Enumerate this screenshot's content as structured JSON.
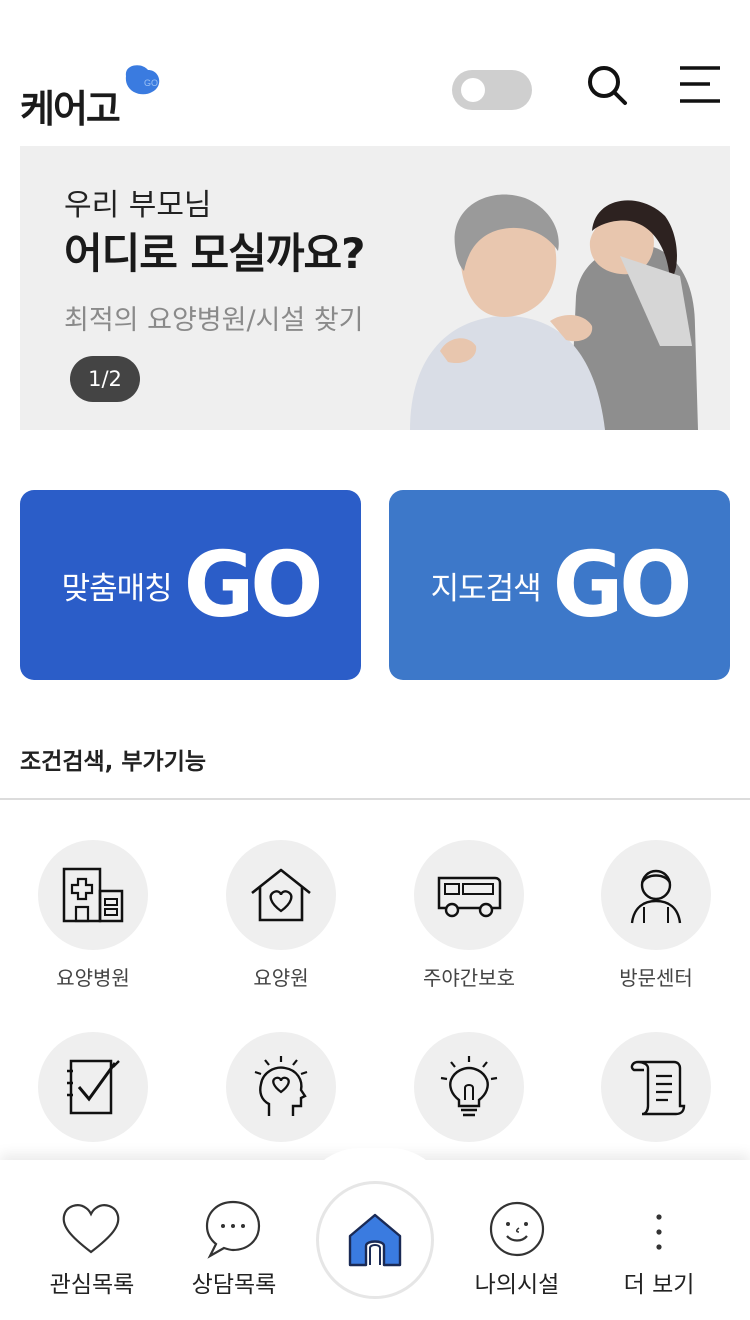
{
  "header": {
    "logo_text": "케어고",
    "logo_badge": "GO",
    "toggle_state": "off",
    "icons": [
      "search-icon",
      "hamburger-menu-icon"
    ]
  },
  "banner": {
    "subtitle": "우리 부모님",
    "title": "어디로 모실까요?",
    "description": "최적의 요양병원/시설 찾기",
    "pager": "1/2"
  },
  "go_buttons": {
    "matching": {
      "label": "맞춤매칭",
      "go": "GO"
    },
    "map": {
      "label": "지도검색",
      "go": "GO"
    }
  },
  "section": {
    "title": "조건검색, 부가기능"
  },
  "grid": [
    {
      "label": "요양병원",
      "icon": "hospital-icon"
    },
    {
      "label": "요양원",
      "icon": "house-heart-icon"
    },
    {
      "label": "주야간보호",
      "icon": "bus-icon"
    },
    {
      "label": "방문센터",
      "icon": "caregiver-icon"
    },
    {
      "label": "",
      "icon": "checklist-icon"
    },
    {
      "label": "",
      "icon": "mind-heart-icon"
    },
    {
      "label": "",
      "icon": "lightbulb-icon"
    },
    {
      "label": "",
      "icon": "scroll-icon"
    }
  ],
  "bottom_nav": {
    "favorites": "관심목록",
    "consult": "상담목록",
    "home": "",
    "my_facility": "나의시설",
    "more": "더 보기"
  },
  "colors": {
    "go_left": "#2b5dc8",
    "go_right": "#3d78c9",
    "logo_blob": "#3a7be0",
    "home_icon": "#3a7be0"
  }
}
